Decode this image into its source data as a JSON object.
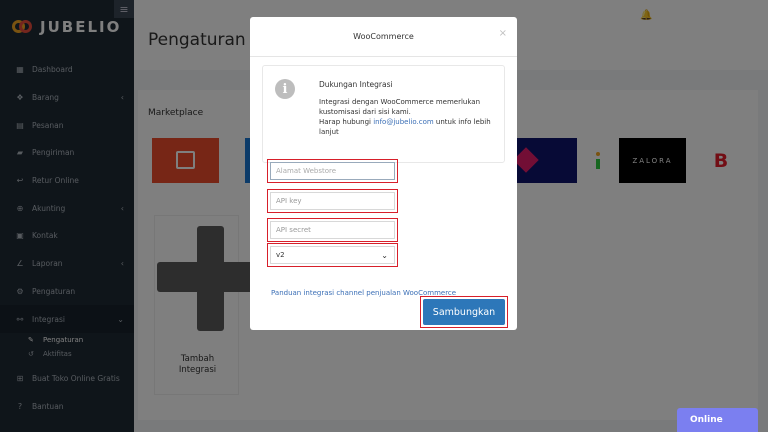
{
  "app": {
    "logo_text": "JUBELIO",
    "menu_icon": "hamburger-icon"
  },
  "sidebar": {
    "items": [
      {
        "label": "Dashboard",
        "icon": "dashboard-icon",
        "chevron": false
      },
      {
        "label": "Barang",
        "icon": "box-icon",
        "chevron": true
      },
      {
        "label": "Pesanan",
        "icon": "cart-icon",
        "chevron": false
      },
      {
        "label": "Pengiriman",
        "icon": "truck-icon",
        "chevron": false
      },
      {
        "label": "Retur Online",
        "icon": "return-icon",
        "chevron": false
      },
      {
        "label": "Akunting",
        "icon": "accounting-icon",
        "chevron": true
      },
      {
        "label": "Kontak",
        "icon": "contact-icon",
        "chevron": false
      },
      {
        "label": "Laporan",
        "icon": "chart-icon",
        "chevron": true
      },
      {
        "label": "Pengaturan",
        "icon": "settings-icon",
        "chevron": false
      },
      {
        "label": "Integrasi",
        "icon": "integration-icon",
        "chevron": true
      }
    ],
    "sub_items": [
      {
        "label": "Pengaturan",
        "icon": "wrench-icon"
      },
      {
        "label": "Aktifitas",
        "icon": "history-icon"
      }
    ],
    "after_items": [
      {
        "label": "Buat Toko Online Gratis",
        "icon": "store-icon"
      },
      {
        "label": "Bantuan",
        "icon": "help-icon"
      }
    ]
  },
  "header": {
    "title": "Pengaturan"
  },
  "main": {
    "section_title": "Marketplace",
    "add_tile_label_1": "Tambah",
    "add_tile_label_2": "Integrasi",
    "zalora_label": "ZALORA",
    "blibli_label": "B"
  },
  "online_button": "Online",
  "modal": {
    "title": "WooCommerce",
    "close": "×",
    "info": {
      "icon": "i",
      "title": "Dukungan Integrasi",
      "line1": "Integrasi dengan WooCommerce memerlukan kustomisasi dari sisi kami.",
      "line2_prefix": "Harap hubungi ",
      "email": "info@jubelio.com",
      "line2_suffix": " untuk info lebih lanjut"
    },
    "fields": {
      "store_address_placeholder": "Alamat Webstore",
      "api_key_placeholder": "API key",
      "api_secret_placeholder": "API secret",
      "version_value": "v2"
    },
    "guide_link": "Panduan integrasi channel penjualan WooCommerce",
    "connect_button": "Sambungkan"
  },
  "colors": {
    "shopee": "#ee4d2d",
    "lazada": "#e51c6a",
    "zalora": "#000000",
    "blibli": "#0095da",
    "connect": "#2d77b9",
    "highlight": "#d71f2a"
  }
}
